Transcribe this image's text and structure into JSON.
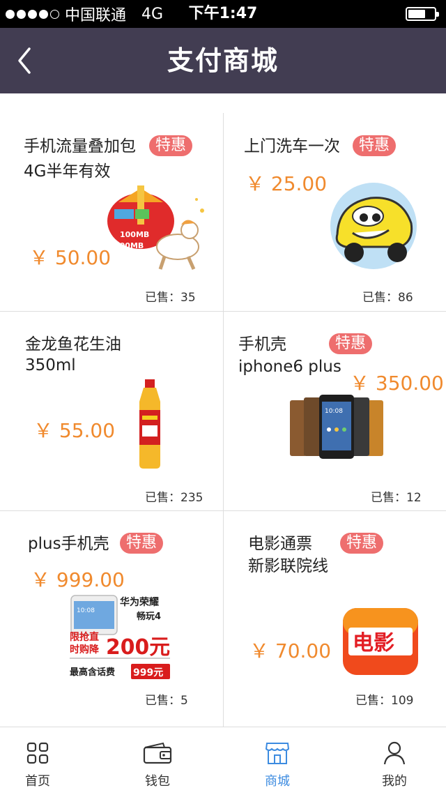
{
  "status_bar": {
    "carrier": "中国联通",
    "network": "4G",
    "time": "下午1:47"
  },
  "nav": {
    "title": "支付商城"
  },
  "products": [
    {
      "title_line1": "手机流量叠加包",
      "title_line2": "4G半年有效",
      "badge": "特惠",
      "price": "￥ 50.00",
      "sold": "已售：35",
      "image_icon": "data-package-gift-icon",
      "image_text1": "100MB",
      "image_text2": "300MB"
    },
    {
      "title_line1": "上门洗车一次",
      "title_line2": "",
      "badge": "特惠",
      "price": "￥ 25.00",
      "sold": "已售：86",
      "image_icon": "cartoon-car-icon"
    },
    {
      "title_line1": "金龙鱼花生油",
      "title_line2": "350ml",
      "badge": "",
      "price": "￥ 55.00",
      "sold": "已售：235",
      "image_icon": "oil-bottle-icon"
    },
    {
      "title_line1": "手机壳",
      "title_line2": "iphone6 plus",
      "badge": "特惠",
      "price": "￥ 350.00",
      "sold": "已售：12",
      "image_icon": "phone-cases-icon",
      "image_time": "10:08"
    },
    {
      "title_line1": "plus手机壳",
      "title_line2": "",
      "badge": "特惠",
      "price": "￥ 999.00",
      "sold": "已售：5",
      "image_icon": "promo-phone-icon",
      "promo": {
        "phone_time": "10:08",
        "brand": "华为荣耀",
        "model": "畅玩4",
        "line1": "限抢直",
        "line2": "时购降",
        "amount": "200元",
        "footer": "最高含话费",
        "footer_amount": "999元"
      }
    },
    {
      "title_line1": "电影通票",
      "title_line2": "新影联院线",
      "badge": "特惠",
      "price": "￥ 70.00",
      "sold": "已售：109",
      "image_icon": "movie-ticket-app-icon",
      "image_text": "电影"
    }
  ],
  "tabs": [
    {
      "label": "首页",
      "icon": "grid-icon",
      "active": false
    },
    {
      "label": "钱包",
      "icon": "wallet-icon",
      "active": false
    },
    {
      "label": "商城",
      "icon": "store-icon",
      "active": true
    },
    {
      "label": "我的",
      "icon": "user-icon",
      "active": false
    }
  ],
  "colors": {
    "nav_bg": "#423d52",
    "badge": "#ee6e6e",
    "price": "#f08a2e",
    "active_tab": "#3c8be0"
  }
}
